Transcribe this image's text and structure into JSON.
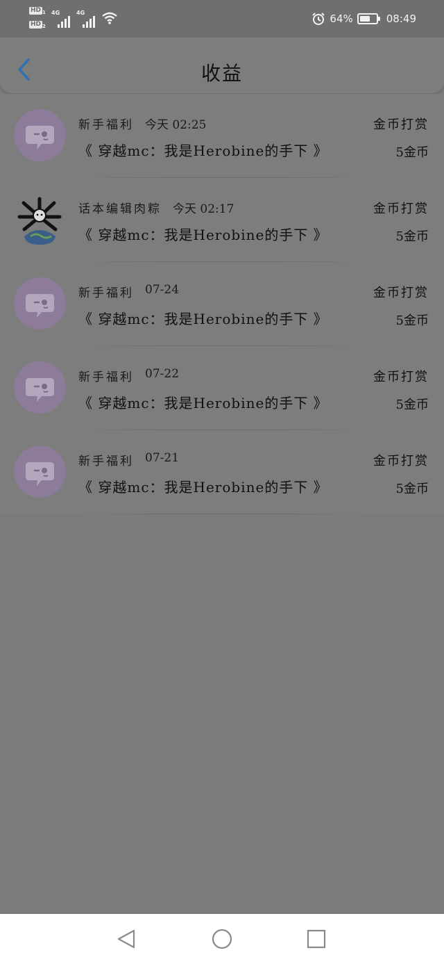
{
  "status_bar": {
    "hd1": "HD",
    "hd2": "HD",
    "sim1": "1",
    "sim2": "2",
    "net1": "4G",
    "net2": "4G",
    "battery_text": "64%",
    "battery_level": 0.64,
    "time": "08:49"
  },
  "header": {
    "title": "收益",
    "back_icon": "chevron-left-icon"
  },
  "colors": {
    "accent": "#2f6fb0",
    "avatar_purple": "#8c7c99",
    "overlay_gray": "#7d7d7d"
  },
  "items": [
    {
      "sender": "新手福利",
      "time": "今天 02:25",
      "book": "《 穿越mc：我是Herobine的手下 》",
      "type": "金币打赏",
      "amount": "5金币",
      "avatar": "chat-bubble-icon"
    },
    {
      "sender": "话本编辑肉粽",
      "time": "今天 02:17",
      "book": "《 穿越mc：我是Herobine的手下 》",
      "type": "金币打赏",
      "amount": "5金币",
      "avatar": "user-avatar-image"
    },
    {
      "sender": "新手福利",
      "time": "07-24",
      "book": "《 穿越mc：我是Herobine的手下 》",
      "type": "金币打赏",
      "amount": "5金币",
      "avatar": "chat-bubble-icon"
    },
    {
      "sender": "新手福利",
      "time": "07-22",
      "book": "《 穿越mc：我是Herobine的手下 》",
      "type": "金币打赏",
      "amount": "5金币",
      "avatar": "chat-bubble-icon"
    },
    {
      "sender": "新手福利",
      "time": "07-21",
      "book": "《 穿越mc：我是Herobine的手下 》",
      "type": "金币打赏",
      "amount": "5金币",
      "avatar": "chat-bubble-icon"
    }
  ],
  "nav": {
    "back": "triangle-back-icon",
    "home": "circle-home-icon",
    "recents": "square-recents-icon"
  }
}
